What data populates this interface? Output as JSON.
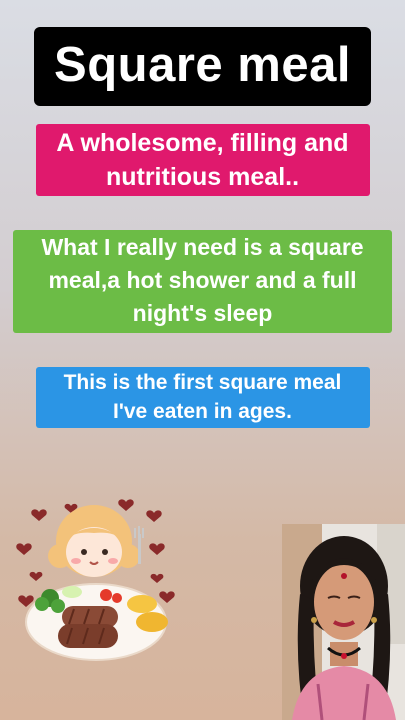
{
  "title": "Square meal",
  "definition": {
    "line1": "A wholesome, filling and",
    "line2": "nutritious meal.."
  },
  "example1": {
    "line1": "What I really need is a square",
    "line2": "meal,a hot shower and a full",
    "line3": "night's sleep"
  },
  "example2": {
    "line1": "This is the first square meal",
    "line2": "I've eaten in ages."
  },
  "colors": {
    "title_bg": "#000000",
    "definition_bg": "#e0196d",
    "example1_bg": "#6cbc46",
    "example2_bg": "#2b95e5"
  },
  "sticker": {
    "icon": "girl-with-meal-sticker"
  },
  "presenter": {
    "icon": "presenter-photo"
  }
}
